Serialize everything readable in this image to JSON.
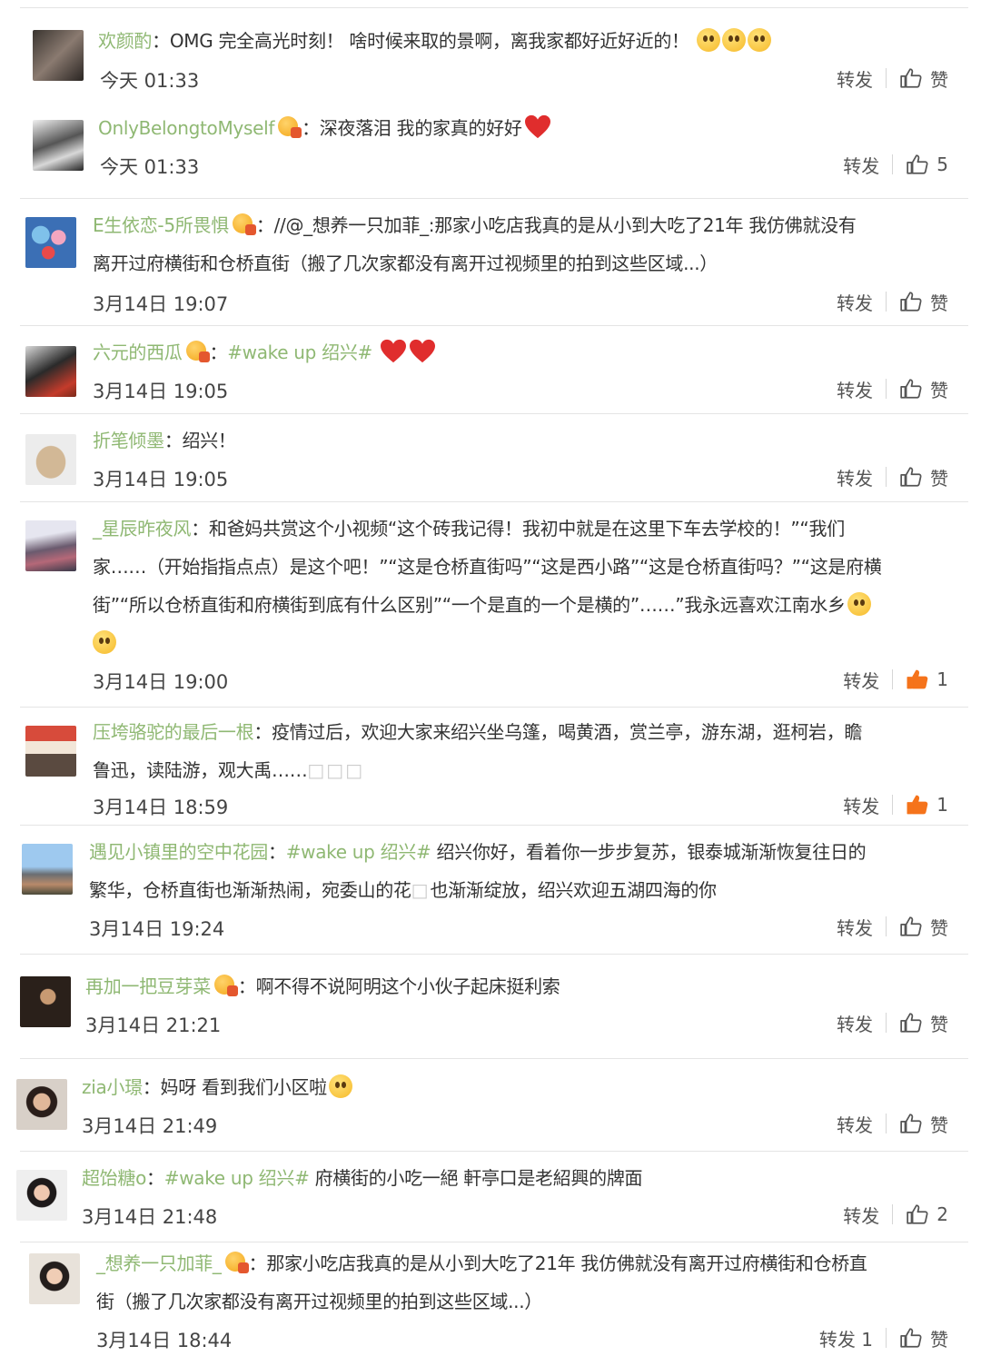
{
  "comments": [
    {
      "user": "欢颜酌",
      "text": "OMG 完全高光时刻！ 啥时候来取的景啊，离我家都好近好近的！",
      "time": "今天 01:33",
      "forward": "转发",
      "like": "赞",
      "emoji_count": 3
    },
    {
      "user": "OnlyBelongtoMyself",
      "text": "深夜落泪 我的家真的好好",
      "time": "今天 01:33",
      "forward": "转发",
      "like": "5"
    },
    {
      "user": "E生依恋-5所畏惧",
      "line1": "//@_想养一只加菲_:那家小吃店我真的是从小到大吃了21年 我仿佛就没有",
      "line2": "离开过府横街和仓桥直街（搬了几次家都没有离开过视频里的拍到这些区域...）",
      "time": "3月14日 19:07",
      "forward": "转发",
      "like": "赞"
    },
    {
      "user": "六元的西瓜",
      "hashtag": "#wake up 绍兴#",
      "time": "3月14日 19:05",
      "forward": "转发",
      "like": "赞"
    },
    {
      "user": "折笔倾墨",
      "text": "绍兴！",
      "time": "3月14日 19:05",
      "forward": "转发",
      "like": "赞"
    },
    {
      "user": "_星辰昨夜风",
      "line1": "和爸妈共赏这个小视频“这个砖我记得！我初中就是在这里下车去学校的！”“我们",
      "line2": "家……（开始指指点点）是这个吧！”“这是仓桥直街吗”“这是西小路”“这是仓桥直街吗？”“这是府横",
      "line3": "街”“所以仓桥直街和府横街到底有什么区别”“一个是直的一个是横的”……”我永远喜欢江南水乡",
      "time": "3月14日 19:00",
      "forward": "转发",
      "like": "1"
    },
    {
      "user": "压垮骆驼的最后一根",
      "line1": "疫情过后，欢迎大家来绍兴坐乌篷，喝黄酒，赏兰亭，游东湖，逛柯岩，瞻",
      "line2": "鲁迅，读陆游，观大禹……",
      "line2_tail": "□□□",
      "time": "3月14日 18:59",
      "forward": "转发",
      "like": "1"
    },
    {
      "user": "遇见小镇里的空中花园",
      "hashtag": "#wake up 绍兴#",
      "line1": " 绍兴你好，看着你一步步复苏，银泰城渐渐恢复往日的",
      "line2": "繁华，仓桥直街也渐渐热闹，宛委山的花",
      "line2_mid": "□",
      "line2_tail": "也渐渐绽放，绍兴欢迎五湖四海的你",
      "time": "3月14日 19:24",
      "forward": "转发",
      "like": "赞"
    },
    {
      "user": "再加一把豆芽菜",
      "text": "啊不得不说阿明这个小伙子起床挺利索",
      "time": "3月14日 21:21",
      "forward": "转发",
      "like": "赞"
    },
    {
      "user": "zia小璟",
      "text": "妈呀 看到我们小区啦",
      "time": "3月14日 21:49",
      "forward": "转发",
      "like": "赞"
    },
    {
      "user": "超饴糖o",
      "hashtag": "#wake up 绍兴#",
      "text": " 府横街的小吃一絕 軒亭口是老紹興的牌面",
      "time": "3月14日 21:48",
      "forward": "转发",
      "like": "2"
    },
    {
      "user": "_想养一只加菲_",
      "line1": "那家小吃店我真的是从小到大吃了21年 我仿佛就没有离开过府横街和仓桥直",
      "line2": "街（搬了几次家都没有离开过视频里的拍到这些区域...）",
      "time": "3月14日 18:44",
      "forward": "转发 1",
      "like": "赞"
    }
  ],
  "colors": {
    "username": "#8fb873",
    "text": "#333333",
    "divider": "#e4e4e4",
    "liked": "#f5731b"
  }
}
